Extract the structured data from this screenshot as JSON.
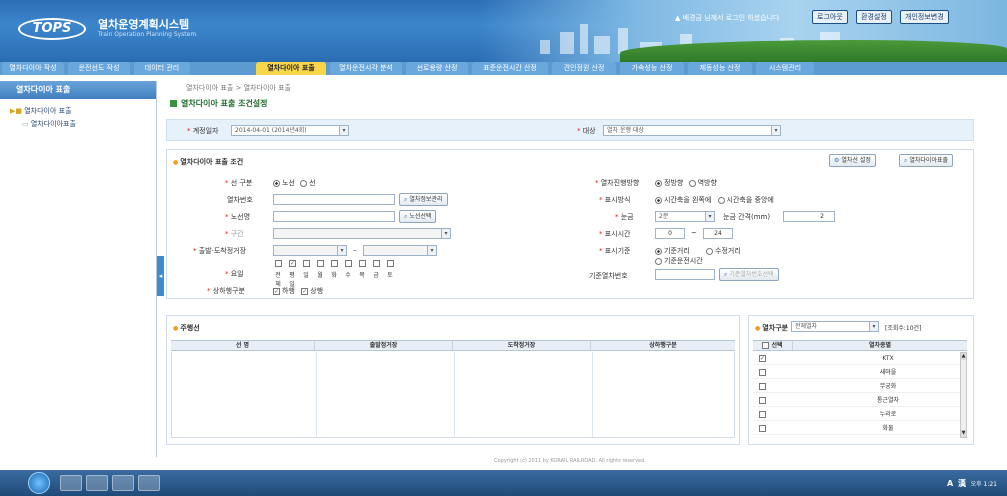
{
  "header": {
    "logo": "TOPS",
    "title": "열차운영계획시스템",
    "subtitle": "Train Operation Planning System",
    "user_info": "▲ 배경금 님께서 로그인 하셨습니다",
    "logout": "로그아웃",
    "settings": "환경설정",
    "info": "개인정보변경"
  },
  "menu": [
    "열차다이아 작성",
    "운전선도 작성",
    "데이터 관리",
    "열차다이아 표출",
    "열차운전시각 분석",
    "선로용량 산정",
    "표준운전시간 산정",
    "견인정원 산정",
    "가속성능 산정",
    "제동성능 산정",
    "시스템관리"
  ],
  "sidebar": {
    "header": "열차다이아 표출",
    "items": [
      {
        "label": "열차다이아 표출"
      },
      {
        "label": "열차다이아표출"
      }
    ]
  },
  "breadcrumb": "열차다이아 표출 > 열차다이아 표출",
  "page_title": "열차다이아 표출 조건설정",
  "filter": {
    "plan_label": "계정일자",
    "plan_value": "2014-04-01 (2014년4회)",
    "target_label": "대상",
    "target_value": "열차 운행 대상"
  },
  "condition": {
    "title": "열차다이아 표출 조건",
    "btn_line": "열차선 설정",
    "btn_print": "열차다이아표출",
    "line_type_label": "선 구분",
    "line_type_opts": [
      "노선",
      "선"
    ],
    "train_no_label": "열차번호",
    "train_no_btn": "열차정보관리",
    "route_label": "노선명",
    "route_btn": "노선선택",
    "section_label": "구간",
    "station_label": "출발·도착정거장",
    "day_label": "요일",
    "days": [
      "전체",
      "평일",
      "일",
      "월",
      "화",
      "수",
      "목",
      "금",
      "토"
    ],
    "dir_label": "상하행구분",
    "dir_opts": [
      "하행",
      "상행"
    ],
    "train_dir_label": "열차진행방향",
    "train_dir_opts": [
      "정방향",
      "역방향"
    ],
    "show_label": "표시방식",
    "show_opts": [
      "시간축을 왼쪽에",
      "시간축을 중앙에"
    ],
    "scale_label": "눈금",
    "scale_value": "2분",
    "scale_interval_label": "눈금 간격(mm)",
    "scale_interval_value": "2",
    "time_label": "표시시간",
    "time_from": "0",
    "time_to": "24",
    "axis_label": "표시기준",
    "axis_opts": [
      "기준거리",
      "수정거리",
      "기준운전시간"
    ],
    "base_train_label": "기준열차번호",
    "base_train_btn": "기준열차번호선택"
  },
  "routes": {
    "title": "주행선",
    "columns": [
      "선 명",
      "출발정거장",
      "도착정거장",
      "상하행구분"
    ]
  },
  "trains": {
    "type_label": "열차구분",
    "type_value": "전체열차",
    "count": "[조회수:10건]",
    "columns": [
      "선택",
      "열차종별"
    ],
    "rows": [
      {
        "name": "KTX",
        "checked": true
      },
      {
        "name": "새마을",
        "checked": false
      },
      {
        "name": "무궁화",
        "checked": false
      },
      {
        "name": "통근열차",
        "checked": false
      },
      {
        "name": "누리로",
        "checked": false
      },
      {
        "name": "화물",
        "checked": false
      }
    ]
  },
  "footer": "Copyright (c) 2011 by KORAIL RAILROAD. All rights reserved.",
  "taskbar": {
    "tray": "A 漢",
    "clock": "오후 1:21"
  }
}
